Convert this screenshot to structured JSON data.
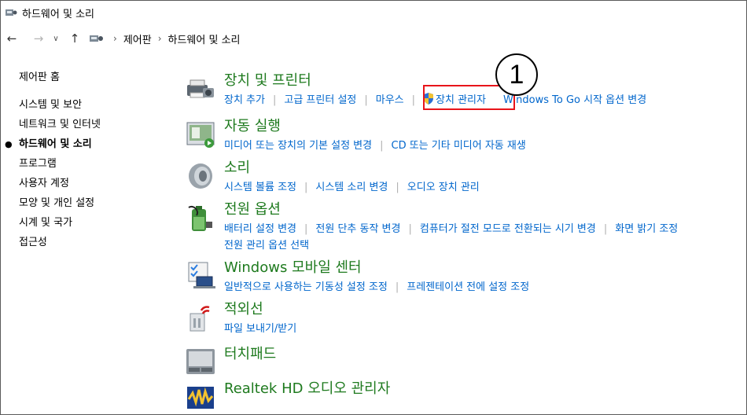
{
  "window": {
    "title": "하드웨어 및 소리"
  },
  "breadcrumb": [
    "제어판",
    "하드웨어 및 소리"
  ],
  "sidebar": {
    "home": "제어판 홈",
    "items": [
      {
        "label": "시스템 및 보안"
      },
      {
        "label": "네트워크 및 인터넷"
      },
      {
        "label": "하드웨어 및 소리",
        "active": true
      },
      {
        "label": "프로그램"
      },
      {
        "label": "사용자 계정"
      },
      {
        "label": "모양 및 개인 설정"
      },
      {
        "label": "시계 및 국가"
      },
      {
        "label": "접근성"
      }
    ]
  },
  "categories": [
    {
      "title": "장치 및 프린터",
      "icon": "printer-icon",
      "links": [
        "장치 추가",
        "고급 프린터 설정",
        "마우스",
        "장치 관리자",
        "Windows To Go 시작 옵션 변경"
      ]
    },
    {
      "title": "자동 실행",
      "icon": "autoplay-icon",
      "links": [
        "미디어 또는 장치의 기본 설정 변경",
        "CD 또는 기타 미디어 자동 재생"
      ]
    },
    {
      "title": "소리",
      "icon": "speaker-icon",
      "links": [
        "시스템 볼륨 조정",
        "시스템 소리 변경",
        "오디오 장치 관리"
      ]
    },
    {
      "title": "전원 옵션",
      "icon": "battery-icon",
      "links": [
        "배터리 설정 변경",
        "전원 단추 동작 변경",
        "컴퓨터가 절전 모드로 전환되는 시기 변경",
        "화면 밝기 조정",
        "전원 관리 옵션 선택"
      ]
    },
    {
      "title": "Windows 모바일 센터",
      "icon": "mobility-center-icon",
      "links": [
        "일반적으로 사용하는 기동성 설정 조정",
        "프레젠테이션 전에 설정 조정"
      ]
    },
    {
      "title": "적외선",
      "icon": "infrared-icon",
      "links": [
        "파일 보내기/받기"
      ]
    },
    {
      "title": "터치패드",
      "icon": "touchpad-icon",
      "links": []
    },
    {
      "title": "Realtek HD 오디오 관리자",
      "icon": "realtek-audio-icon",
      "links": []
    }
  ],
  "annotation": {
    "number": "1"
  },
  "colors": {
    "category_title": "#1e7a1e",
    "link": "#0066cc",
    "highlight": "#e8141a"
  }
}
